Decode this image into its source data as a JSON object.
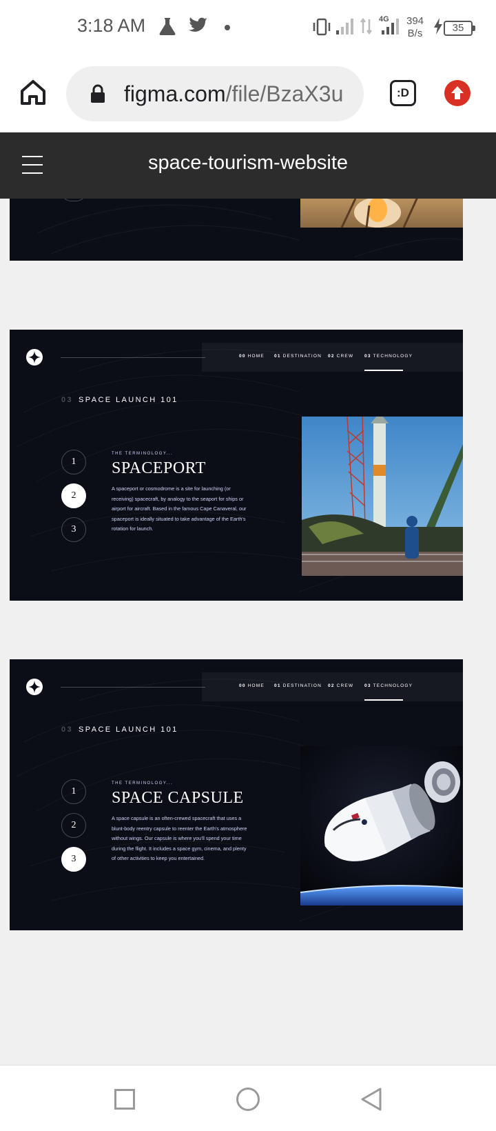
{
  "status_bar": {
    "time": "3:18 AM",
    "net_speed_value": "394",
    "net_speed_unit": "B/s",
    "network_label": "4G",
    "battery": "35"
  },
  "browser": {
    "url_domain": "figma.com",
    "url_path": "/file/BzaX3u",
    "extension_label": ":D"
  },
  "figma": {
    "file_title": "space-tourism-website"
  },
  "nav": [
    {
      "num": "00",
      "label": "HOME"
    },
    {
      "num": "01",
      "label": "DESTINATION"
    },
    {
      "num": "02",
      "label": "CREW"
    },
    {
      "num": "03",
      "label": "TECHNOLOGY"
    }
  ],
  "frames": [
    {
      "section_num": "03",
      "section_label": "SPACE LAUNCH 101",
      "steps": [
        "1",
        "2",
        "3"
      ],
      "active_step": 2,
      "eyebrow": "THE TERMINOLOGY...",
      "title": "SPACEPORT",
      "description": "A spaceport or cosmodrome is a site for launching (or receiving) spacecraft, by analogy to the seaport for ships or airport for aircraft. Based in the famous Cape Canaveral, our spaceport is ideally situated to take advantage of the Earth's rotation for launch."
    },
    {
      "section_num": "03",
      "section_label": "SPACE LAUNCH 101",
      "steps": [
        "1",
        "2",
        "3"
      ],
      "active_step": 3,
      "eyebrow": "THE TERMINOLOGY...",
      "title": "SPACE CAPSULE",
      "description": "A space capsule is an often-crewed spacecraft that uses a blunt-body reentry capsule to reenter the Earth's atmosphere without wings. Our capsule is where you'll spend your time during the flight. It includes a space gym, cinema, and plenty of other activities to keep you entertained."
    }
  ],
  "colors": {
    "frame_bg": "#0b0d17",
    "accent_text": "#d0d6f9",
    "figma_header": "#2c2c2c",
    "upload_red": "#d93025"
  }
}
